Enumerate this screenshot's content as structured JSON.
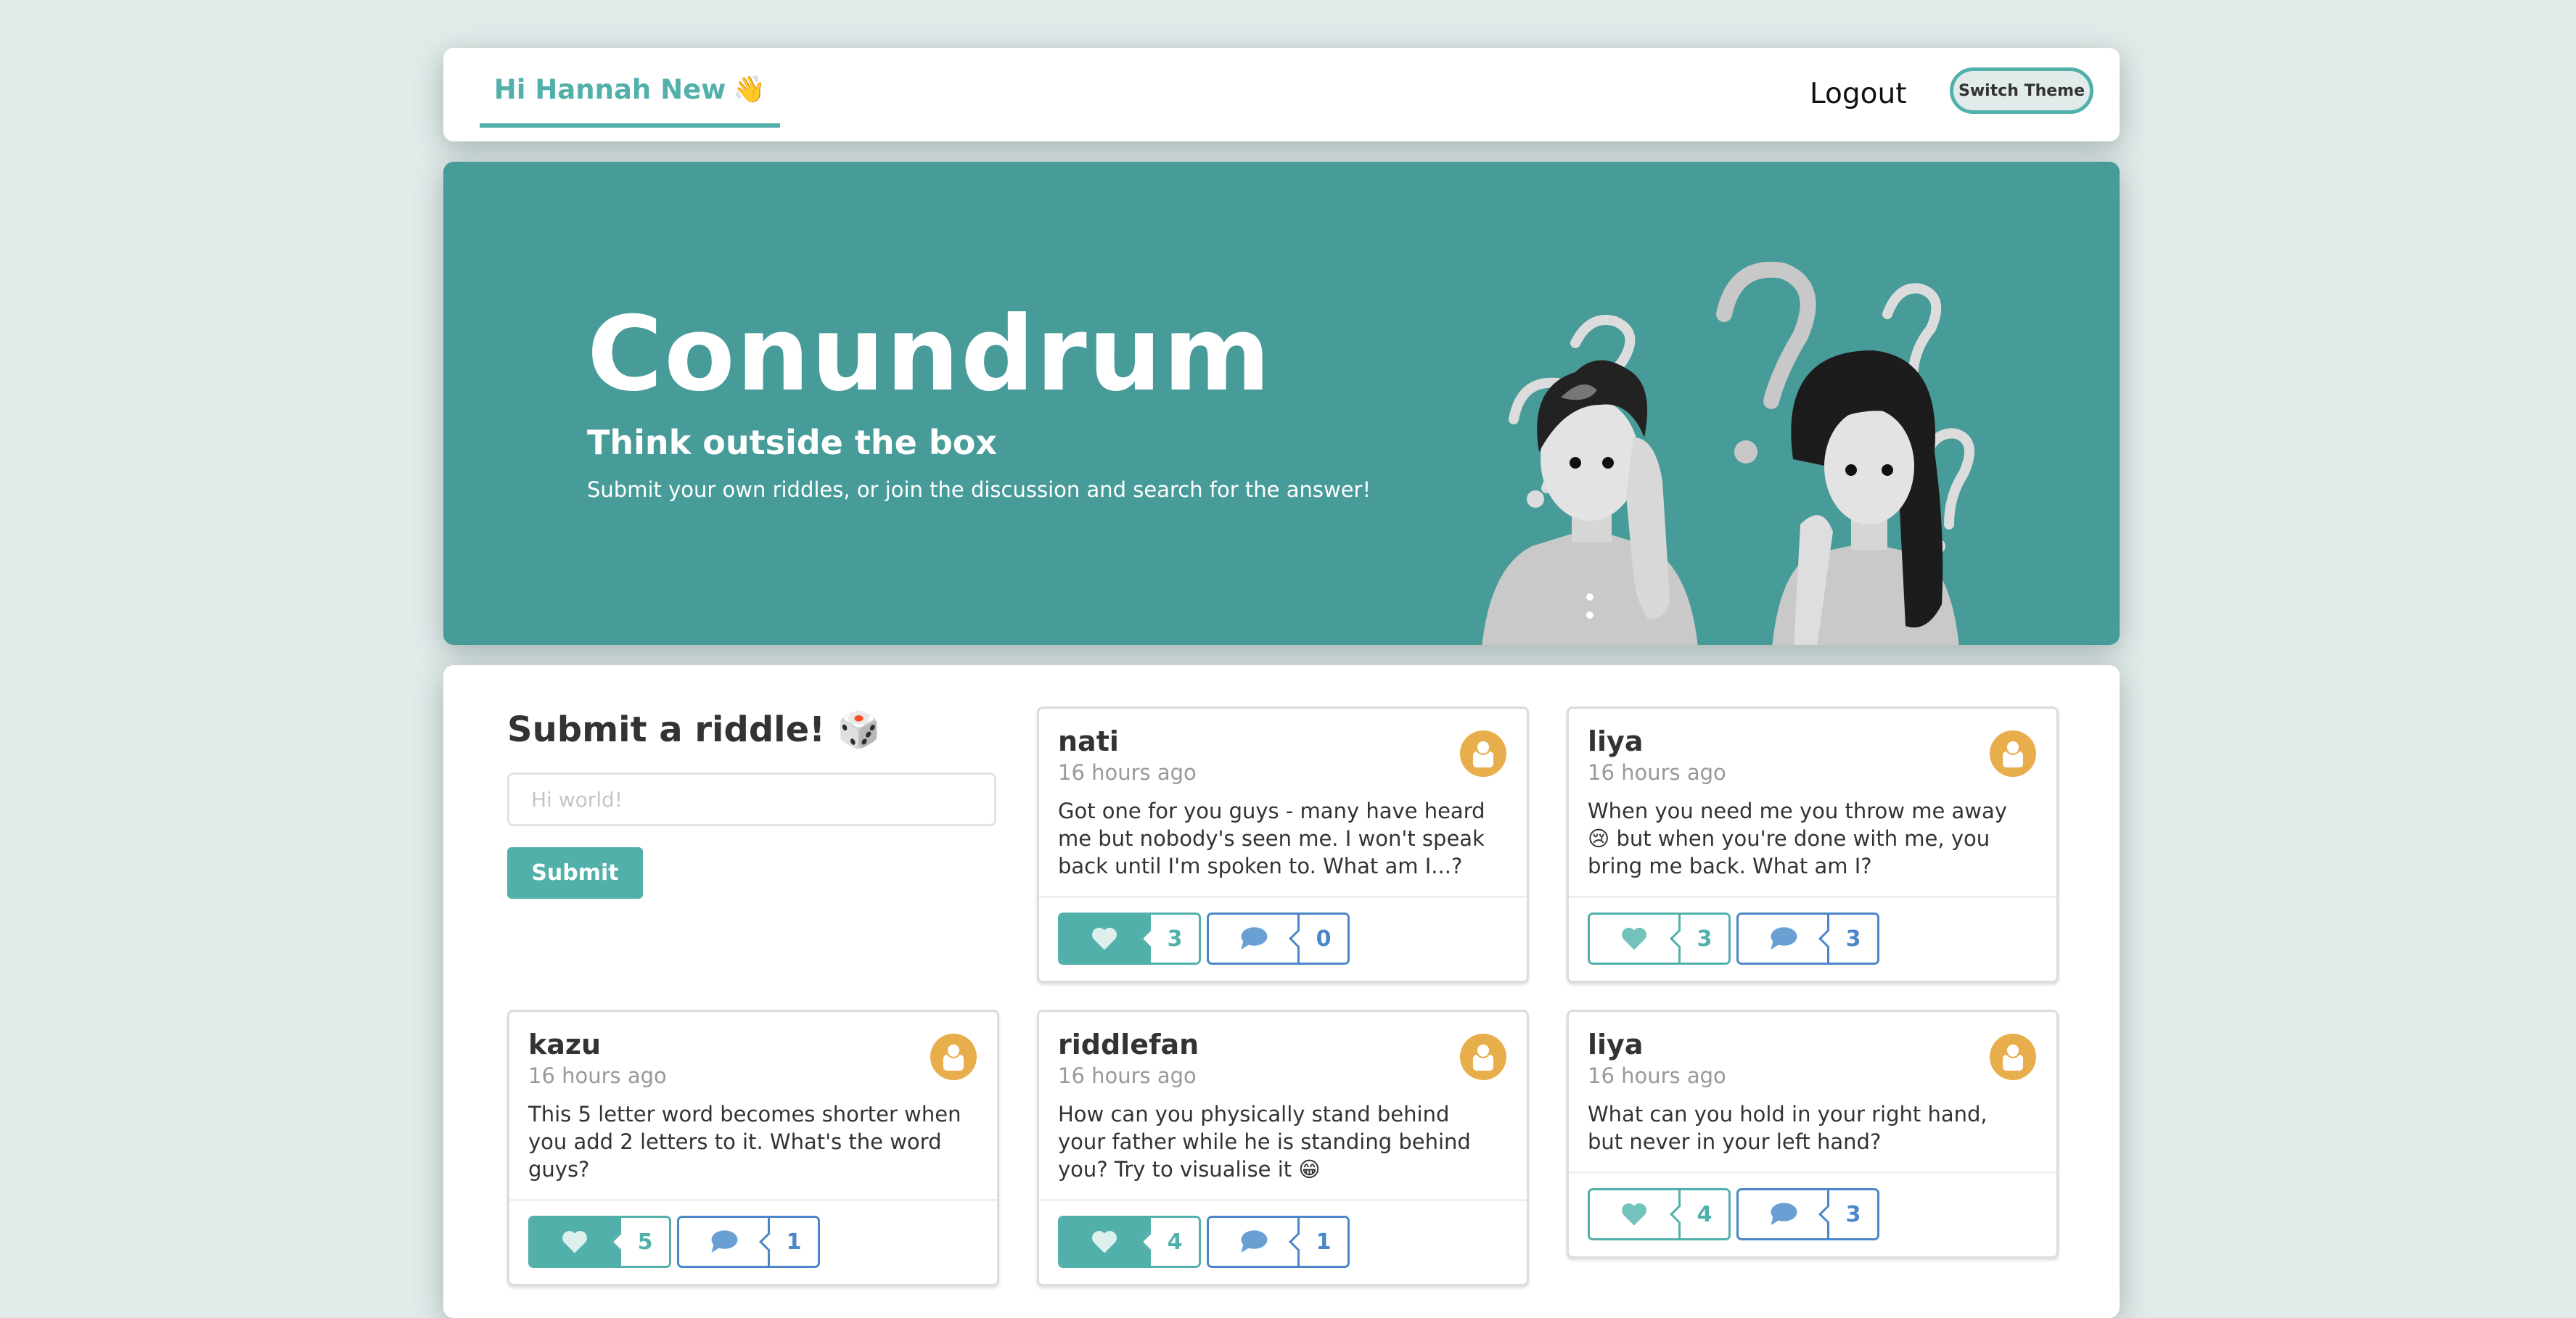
{
  "nav": {
    "greeting": "Hi Hannah New",
    "greeting_emoji": "👋",
    "logout_label": "Logout",
    "switch_theme_label": "Switch Theme"
  },
  "hero": {
    "title": "Conundrum",
    "subtitle": "Think outside the box",
    "description": "Submit your own riddles, or join the discussion and search for the answer!",
    "illustration": "confused-people-question-marks"
  },
  "submit": {
    "title": "Submit a riddle!",
    "title_emoji": "🎲",
    "input_placeholder": "Hi world!",
    "input_value": "",
    "button_label": "Submit"
  },
  "colors": {
    "accent": "#52b0ab",
    "hero_bg": "#479b98",
    "page_bg": "#e1ebea",
    "comment_blue": "#4a86c8",
    "avatar": "#e8ae4b"
  },
  "riddles": [
    {
      "author": "nati",
      "time": "16 hours ago",
      "text": "Got one for you guys - many have heard me but nobody's seen me. I won't speak back until I'm spoken to. What am I...?",
      "likes": "3",
      "liked": true,
      "comments": "0"
    },
    {
      "author": "liya",
      "time": "16 hours ago",
      "text": "When you need me you throw me away 😢 but when you're done with me, you bring me back. What am I?",
      "likes": "3",
      "liked": false,
      "comments": "3"
    },
    {
      "author": "kazu",
      "time": "16 hours ago",
      "text": "This 5 letter word becomes shorter when you add 2 letters to it. What's the word guys?",
      "likes": "5",
      "liked": true,
      "comments": "1"
    },
    {
      "author": "riddlefan",
      "time": "16 hours ago",
      "text": "How can you physically stand behind your father while he is standing behind you? Try to visualise it 😁",
      "likes": "4",
      "liked": true,
      "comments": "1"
    },
    {
      "author": "liya",
      "time": "16 hours ago",
      "text": "What can you hold in your right hand, but never in your left hand?",
      "likes": "4",
      "liked": false,
      "comments": "3"
    }
  ]
}
